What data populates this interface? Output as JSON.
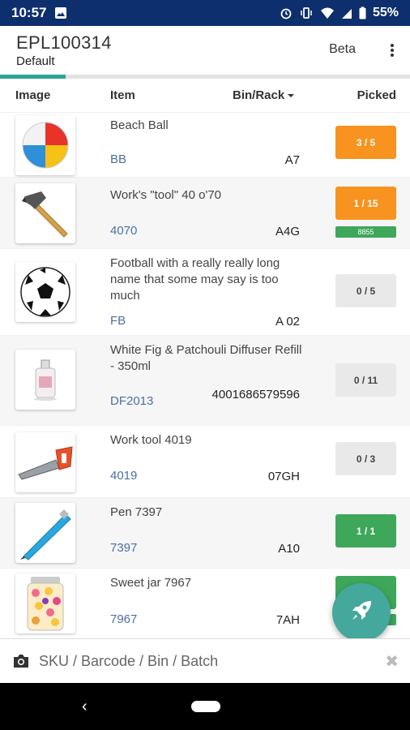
{
  "status": {
    "time": "10:57",
    "battery": "55%"
  },
  "header": {
    "title": "EPL100314",
    "subtitle": "Default",
    "beta_label": "Beta"
  },
  "progress": {
    "fraction": 0.16
  },
  "columns": {
    "image": "Image",
    "item": "Item",
    "bin": "Bin/Rack",
    "picked": "Picked"
  },
  "items": [
    {
      "name": "Beach Ball",
      "sku": "BB",
      "bin": "A7",
      "picked": "3 / 5",
      "state": "orange",
      "icon": "beach-ball-icon"
    },
    {
      "name": "Work's \"tool\" 40 o'70",
      "sku": "4070",
      "bin": "A4G",
      "picked": "1 / 15",
      "state": "orange",
      "batch": "8855",
      "icon": "hammer-icon"
    },
    {
      "name": "Football with a really really long name that some may say is too much",
      "sku": "FB",
      "bin": "A 02",
      "picked": "0 / 5",
      "state": "grey",
      "icon": "football-icon"
    },
    {
      "name": "White Fig & Patchouli Diffuser Refill - 350ml",
      "sku": "DF2013",
      "bin": "4001686579596",
      "picked": "0 / 11",
      "state": "grey",
      "icon": "diffuser-bottle-icon"
    },
    {
      "name": "Work tool 4019",
      "sku": "4019",
      "bin": "07GH",
      "picked": "0 / 3",
      "state": "grey",
      "icon": "saw-icon"
    },
    {
      "name": "Pen 7397",
      "sku": "7397",
      "bin": "A10",
      "picked": "1 / 1",
      "state": "green",
      "icon": "pen-icon"
    },
    {
      "name": "Sweet jar 7967",
      "sku": "7967",
      "bin": "7AH",
      "picked": "",
      "state": "green",
      "icon": "sweet-jar-icon"
    }
  ],
  "search": {
    "placeholder": "SKU / Barcode / Bin / Batch"
  },
  "colors": {
    "statusbar": "#0d2f6e",
    "accent": "#2aa39a",
    "orange": "#f7931e",
    "green": "#3ea75a",
    "sku": "#4a6fa5",
    "fab": "#45a89c"
  }
}
